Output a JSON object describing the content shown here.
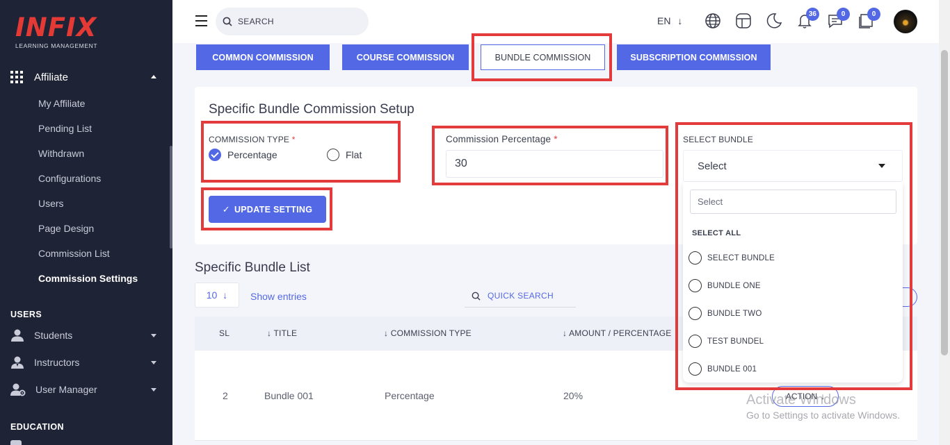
{
  "brand": {
    "name": "INFIX",
    "tagline": "LEARNING MANAGEMENT",
    "accent": "#5368e5",
    "highlight": "#e33b3b"
  },
  "sidebar": {
    "parent": {
      "label": "Affiliate",
      "icon": "grid-icon"
    },
    "items": [
      {
        "label": "My Affiliate"
      },
      {
        "label": "Pending List"
      },
      {
        "label": "Withdrawn"
      },
      {
        "label": "Configurations"
      },
      {
        "label": "Users"
      },
      {
        "label": "Page Design"
      },
      {
        "label": "Commission List"
      },
      {
        "label": "Commission Settings",
        "active": true
      }
    ],
    "sections": {
      "users": "USERS",
      "education": "EDUCATION"
    },
    "user_items": [
      {
        "label": "Students",
        "icon": "student-icon"
      },
      {
        "label": "Instructors",
        "icon": "instructor-icon"
      },
      {
        "label": "User Manager",
        "icon": "user-manager-icon"
      }
    ]
  },
  "header": {
    "search_placeholder": "SEARCH",
    "language": "EN",
    "notifications": {
      "bell": "36",
      "chat": "0",
      "messages": "0"
    }
  },
  "tabs": [
    {
      "label": "COMMON COMMISSION"
    },
    {
      "label": "COURSE COMMISSION"
    },
    {
      "label": "BUNDLE COMMISSION",
      "active": true
    },
    {
      "label": "SUBSCRIPTION COMMISSION"
    }
  ],
  "setup": {
    "title": "Specific Bundle Commission Setup",
    "commission_type_label": "COMMISSION TYPE",
    "required": "*",
    "options": {
      "percentage": "Percentage",
      "flat": "Flat"
    },
    "selected": "percentage",
    "percentage_label": "Commission Percentage",
    "percentage_value": "30",
    "select_bundle_label": "SELECT BUNDLE",
    "select_value": "Select",
    "update_button": "UPDATE SETTING"
  },
  "dropdown": {
    "search_placeholder": "Select",
    "select_all": "SELECT ALL",
    "options": [
      "SELECT BUNDLE",
      "BUNDLE ONE",
      "BUNDLE TWO",
      "TEST BUNDEL",
      "BUNDLE 001"
    ]
  },
  "list": {
    "title": "Specific Bundle List",
    "entries": "10",
    "show_entries": "Show entries",
    "quick_search": "QUICK SEARCH",
    "columns": {
      "sl": "SL",
      "title": "TITLE",
      "type": "COMMISSION TYPE",
      "amount": "AMOUNT / PERCENTAGE"
    },
    "rows": [
      {
        "sl": "2",
        "title": "Bundle 001",
        "type": "Percentage",
        "amount": "20%",
        "action": "ACTION"
      }
    ]
  },
  "watermark": {
    "line1": "Activate Windows",
    "line2": "Go to Settings to activate Windows."
  }
}
